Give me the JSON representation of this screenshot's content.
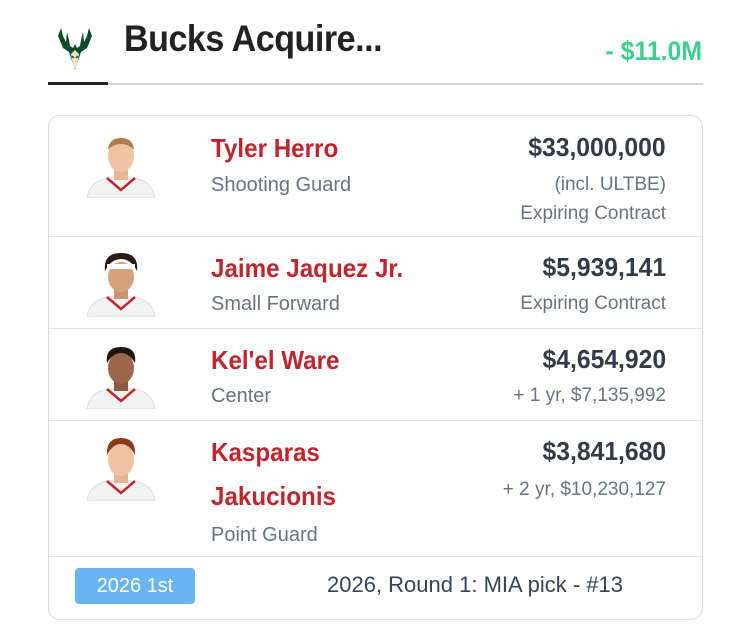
{
  "header": {
    "title": "Bucks Acquire...",
    "net_change": "- $11.0M",
    "team_logo_icon": "bucks-deer-logo-icon"
  },
  "colors": {
    "player_name": "#c0262d",
    "net_change": "#3ecf8e",
    "pick_badge": "#6ab4f2"
  },
  "players": [
    {
      "name": "Tyler Herro",
      "position": "Shooting Guard",
      "salary": "$33,000,000",
      "notes": [
        "(incl. ULTBE)",
        "Expiring Contract"
      ]
    },
    {
      "name": "Jaime Jaquez Jr.",
      "position": "Small Forward",
      "salary": "$5,939,141",
      "notes": [
        "Expiring Contract"
      ]
    },
    {
      "name": "Kel'el Ware",
      "position": "Center",
      "salary": "$4,654,920",
      "notes": [
        "+ 1 yr, $7,135,992"
      ]
    },
    {
      "name_lines": [
        "Kasparas",
        "Jakucionis"
      ],
      "position": "Point Guard",
      "salary": "$3,841,680",
      "notes": [
        "+ 2 yr, $10,230,127"
      ]
    }
  ],
  "draft_pick": {
    "badge": "2026 1st",
    "description": "2026, Round 1: MIA pick - #13"
  }
}
